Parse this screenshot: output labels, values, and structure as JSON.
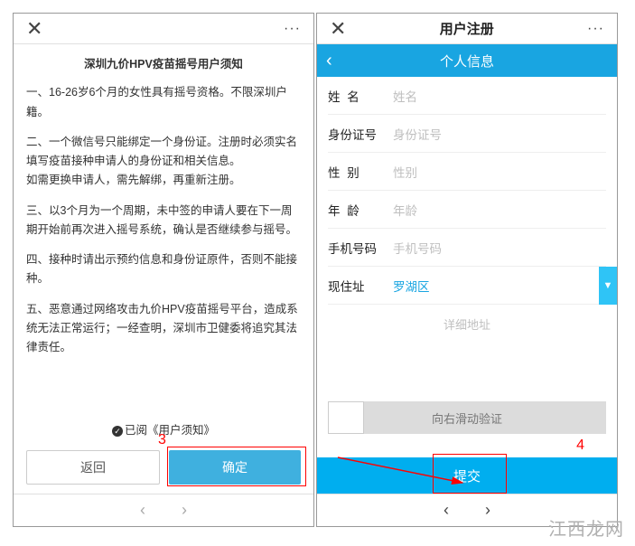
{
  "left": {
    "close": "✕",
    "more": "···",
    "title": "深圳九价HPV疫苗摇号用户须知",
    "p1": "一、16-26岁6个月的女性具有摇号资格。不限深圳户籍。",
    "p2a": "二、一个微信号只能绑定一个身份证。注册时必须实名填写疫苗接种申请人的身份证和相关信息。",
    "p2b": "如需更换申请人，需先解绑，再重新注册。",
    "p3": "三、以3个月为一个周期，未中签的申请人要在下一周期开始前再次进入摇号系统，确认是否继续参与摇号。",
    "p4": "四、接种时请出示预约信息和身份证原件，否则不能接种。",
    "p5": "五、恶意通过网络攻击九价HPV疫苗摇号平台，造成系统无法正常运行；一经查明，深圳市卫健委将追究其法律责任。",
    "agree": "已阅《用户须知》",
    "back_btn": "返回",
    "ok_btn": "确定",
    "nav_back": "‹",
    "nav_fwd": "›"
  },
  "right": {
    "close": "✕",
    "more": "···",
    "header": "用户注册",
    "subheader": "个人信息",
    "back_chev": "‹",
    "fields": {
      "name_label": "姓  名",
      "name_ph": "姓名",
      "id_label": "身份证号",
      "id_ph": "身份证号",
      "sex_label": "性  别",
      "sex_ph": "性别",
      "age_label": "年  龄",
      "age_ph": "年龄",
      "phone_label": "手机号码",
      "phone_ph": "手机号码",
      "addr_label": "现住址",
      "addr_val": "罗湖区",
      "addr_arrow": "▼",
      "detail_ph": "详细地址"
    },
    "slider": "向右滑动验证",
    "submit": "提交",
    "nav_back": "‹",
    "nav_fwd": "›"
  },
  "anno": {
    "step3": "3",
    "step4": "4"
  },
  "watermark": "江西龙网"
}
